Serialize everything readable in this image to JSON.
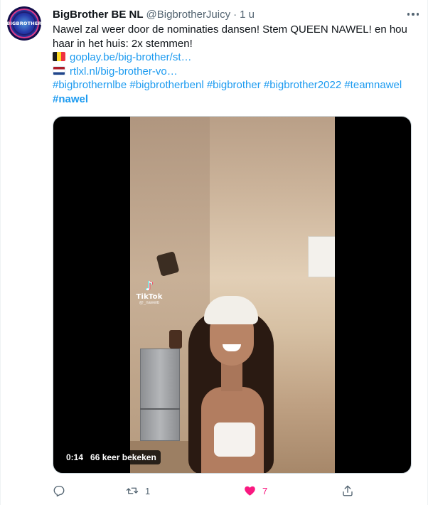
{
  "tweet": {
    "author_name": "BigBrother BE NL",
    "handle": "@BigbrotherJuicy",
    "separator": "·",
    "time": "1 u",
    "avatar_text": "BIGBROTHER",
    "body_line1": "Nawel zal weer door de nominaties dansen! Stem QUEEN NAWEL!  en hou",
    "body_line2": "haar in het huis: 2x stemmen!",
    "link_be": "goplay.be/big-brother/st…",
    "link_nl": "rtlxl.nl/big-brother-vo…",
    "hashtags": [
      "#bigbrothernlbe",
      "#bigbrotherbenl",
      "#bigbrother",
      "#bigbrother2022",
      "#teamnawel"
    ],
    "hashtag_last": "#nawel"
  },
  "media": {
    "watermark_label": "TikTok",
    "watermark_handle": "@_nawelb",
    "duration": "0:14",
    "views": "66 keer bekeken"
  },
  "actions": {
    "reply_count": "",
    "retweet_count": "1",
    "like_count": "7",
    "like_color": "#f91880",
    "accent_color": "#1d9bf0"
  },
  "icons": {
    "more": "more-dots-icon",
    "reply": "reply-icon",
    "retweet": "retweet-icon",
    "like": "heart-icon",
    "share": "share-icon",
    "tiktok": "tiktok-logo-icon"
  }
}
